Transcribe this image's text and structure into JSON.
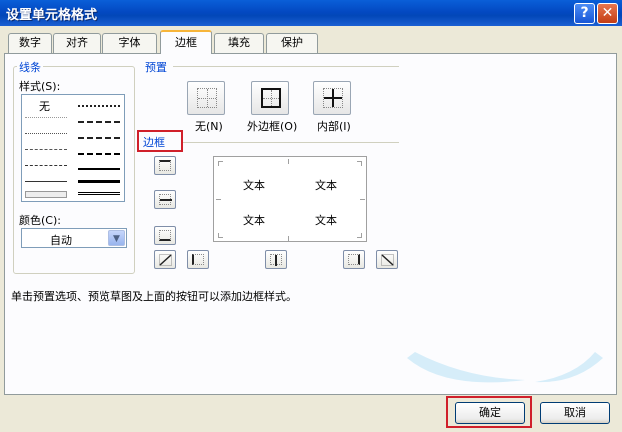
{
  "window": {
    "title": "设置单元格格式",
    "help_glyph": "?",
    "close_glyph": "✕"
  },
  "tabs": [
    {
      "label": "数字"
    },
    {
      "label": "对齐"
    },
    {
      "label": "字体"
    },
    {
      "label": "边框",
      "active": true
    },
    {
      "label": "填充"
    },
    {
      "label": "保护"
    }
  ],
  "line": {
    "group_label": "线条",
    "style_label": "样式(S):",
    "none_label": "无",
    "color_label": "颜色(C):",
    "color_value": "自动"
  },
  "presets": {
    "group_label": "预置",
    "none_label": "无(N)",
    "outline_label": "外边框(O)",
    "inside_label": "内部(I)"
  },
  "border": {
    "group_label": "边框",
    "preview_text": [
      "文本",
      "文本",
      "文本",
      "文本"
    ]
  },
  "hint": "单击预置选项、预览草图及上面的按钮可以添加边框样式。",
  "buttons": {
    "ok": "确定",
    "cancel": "取消"
  },
  "colors": {
    "title_bar": "#0349c2",
    "group_label": "#0046d5",
    "highlight": "#d0202a",
    "active_tab_accent": "#f7b53a"
  },
  "icons": [
    "help-icon",
    "close-icon",
    "dropdown-arrow-icon",
    "preset-none-icon",
    "preset-outline-icon",
    "preset-inside-icon",
    "border-top-icon",
    "border-middle-horizontal-icon",
    "border-bottom-icon",
    "border-diagonal-up-icon",
    "border-left-icon",
    "border-middle-vertical-icon",
    "border-right-icon",
    "border-diagonal-down-icon"
  ]
}
